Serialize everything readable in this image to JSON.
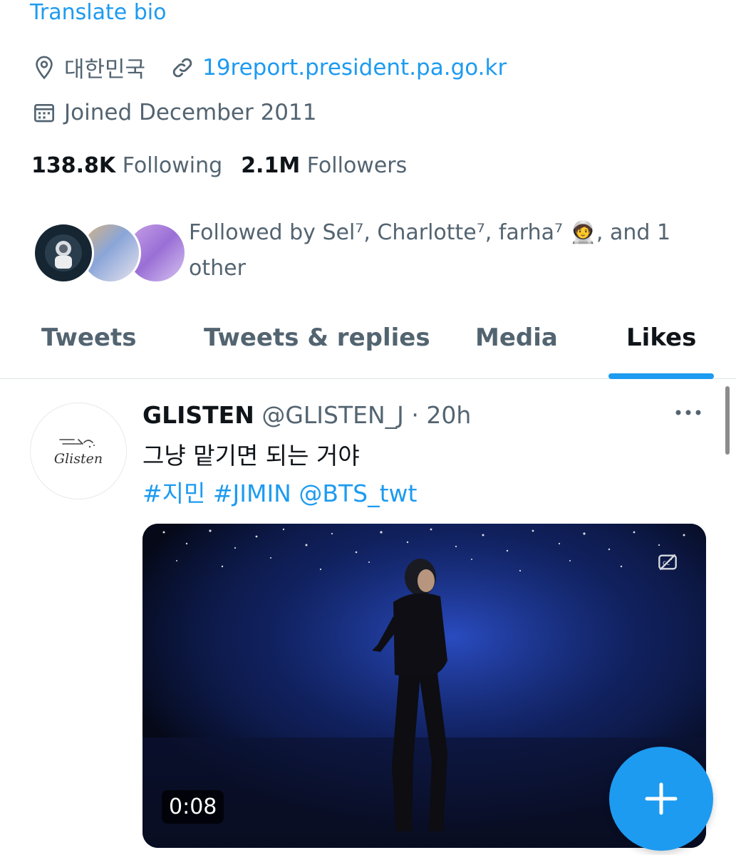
{
  "profile": {
    "translate_bio": "Translate bio",
    "location": "대한민국",
    "website": "19report.president.pa.go.kr",
    "joined": "Joined December 2011",
    "following_count": "138.8K",
    "following_label": "Following",
    "followers_count": "2.1M",
    "followers_label": "Followers",
    "followed_by": "Followed by Sel⁷, Charlotte⁷, farha⁷ 🧑‍🚀, and 1 other"
  },
  "tabs": [
    {
      "label": "Tweets"
    },
    {
      "label": "Tweets & replies"
    },
    {
      "label": "Media"
    },
    {
      "label": "Likes"
    }
  ],
  "tweet": {
    "avatar_text": "Glisten",
    "name": "GLISTEN",
    "handle": "@GLISTEN_J",
    "time": "· 20h",
    "text": "그냥 맡기면 되는 거야",
    "tags": "#지민 #JIMIN @BTS_twt",
    "video_duration": "0:08"
  },
  "icons": {
    "location": "location-pin-icon",
    "link": "link-icon",
    "calendar": "calendar-icon",
    "more": "more-dots-icon",
    "captions": "captions-off-icon",
    "compose": "plus-icon"
  },
  "colors": {
    "accent": "#1d9bf0",
    "muted": "#536471",
    "text": "#0f1419"
  }
}
